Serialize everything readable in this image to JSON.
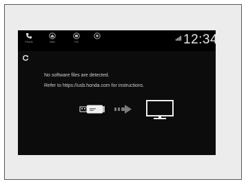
{
  "status_bar": {
    "items": [
      {
        "label": "Phone",
        "icon": "phone-icon"
      },
      {
        "label": "Navi",
        "icon": "home-icon"
      },
      {
        "label": "FM",
        "icon": "radio-icon"
      },
      {
        "label": "",
        "icon": "settings-icon"
      }
    ],
    "signal_icon": "signal-icon",
    "time": "12:34"
  },
  "toolbar": {
    "refresh_icon": "refresh-icon"
  },
  "message": {
    "line1": "No software files are detected.",
    "line2": "Refer to https://usb.honda.com for instructions."
  },
  "illustration": {
    "usb_icon": "usb-drive-icon",
    "arrow_icon": "arrow-right-icon",
    "display_icon": "display-icon"
  },
  "colors": {
    "screen_background": "#0c0c0c",
    "text": "#d0d0d0",
    "illustration": "#f0f0f0",
    "arrow": "#7a7a7a"
  }
}
